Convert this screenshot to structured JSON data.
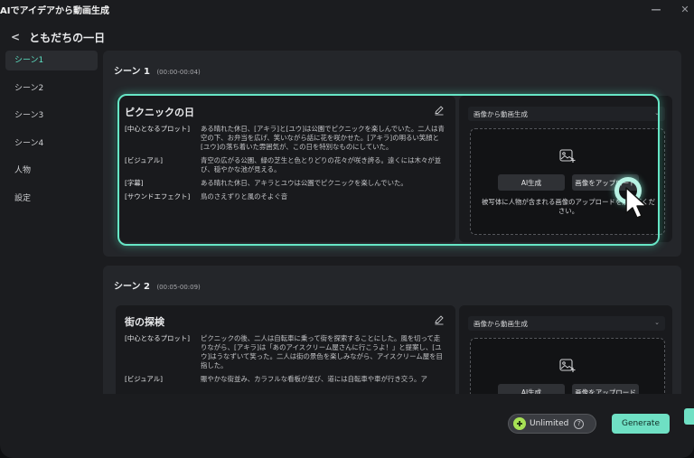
{
  "window": {
    "title": "AIでアイデアから動画生成",
    "minimize_icon": "minimize-icon",
    "close_icon": "close-icon"
  },
  "project": {
    "back_icon": "chevron-left-icon",
    "name": "ともだちの一日"
  },
  "sidebar": {
    "items": [
      {
        "label": "シーン1",
        "active": true
      },
      {
        "label": "シーン2",
        "active": false
      },
      {
        "label": "シーン3",
        "active": false
      },
      {
        "label": "シーン4",
        "active": false
      },
      {
        "label": "人物",
        "active": false
      },
      {
        "label": "設定",
        "active": false
      }
    ]
  },
  "scenes": [
    {
      "heading": "シーン 1",
      "time": "(00:00-00:04)",
      "title": "ピクニックの日",
      "rows": [
        {
          "label": "[中心となるプロット]",
          "value": "ある晴れた休日、[アキラ]と[ユウ]は公園でピクニックを楽しんでいた。二人は青空の下、お弁当を広げ、笑いながら話に花を咲かせた。[アキラ]の明るい笑顔と[ユウ]の落ち着いた雰囲気が、この日を特別なものにしていた。"
        },
        {
          "label": "[ビジュアル]",
          "value": "青空の広がる公園、緑の芝生と色とりどりの花々が咲き誇る。遠くには木々が並び、穏やかな池が見える。"
        },
        {
          "label": "[字幕]",
          "value": "ある晴れた休日、アキラとユウは公園でピクニックを楽しんでいた。"
        },
        {
          "label": "[サウンドエフェクト]",
          "value": "鳥のさえずりと風のそよぐ音"
        }
      ],
      "mode": "画像から動画生成",
      "ai_button": "AI生成",
      "upload_button": "画像をアップロード",
      "hint": "被写体に人物が含まれる画像のアップロードを続けてください。"
    },
    {
      "heading": "シーン 2",
      "time": "(00:05-00:09)",
      "title": "街の探検",
      "rows": [
        {
          "label": "[中心となるプロット]",
          "value": "ピクニックの後、二人は自転車に乗って街を探索することにした。風を切って走りながら、[アキラ]は「あのアイスクリーム屋さんに行こうよ！」と提案し、[ユウ]はうなずいて笑った。二人は街の景色を楽しみながら、アイスクリーム屋を目指した。"
        },
        {
          "label": "[ビジュアル]",
          "value": "賑やかな街並み、カラフルな看板が並び、道には自転車や車が行き交う。ア"
        }
      ],
      "mode": "画像から動画生成",
      "ai_button": "AI生成",
      "upload_button": "画像をアップロード"
    }
  ],
  "footer": {
    "plan_label": "Unlimited",
    "plan_icon": "plus-circle-icon",
    "help_icon": "question-icon",
    "generate_label": "Generate"
  },
  "colors": {
    "accent": "#6fe0c4",
    "active_text": "#5de2c4",
    "panel": "#24262a",
    "card": "#191a1d"
  }
}
